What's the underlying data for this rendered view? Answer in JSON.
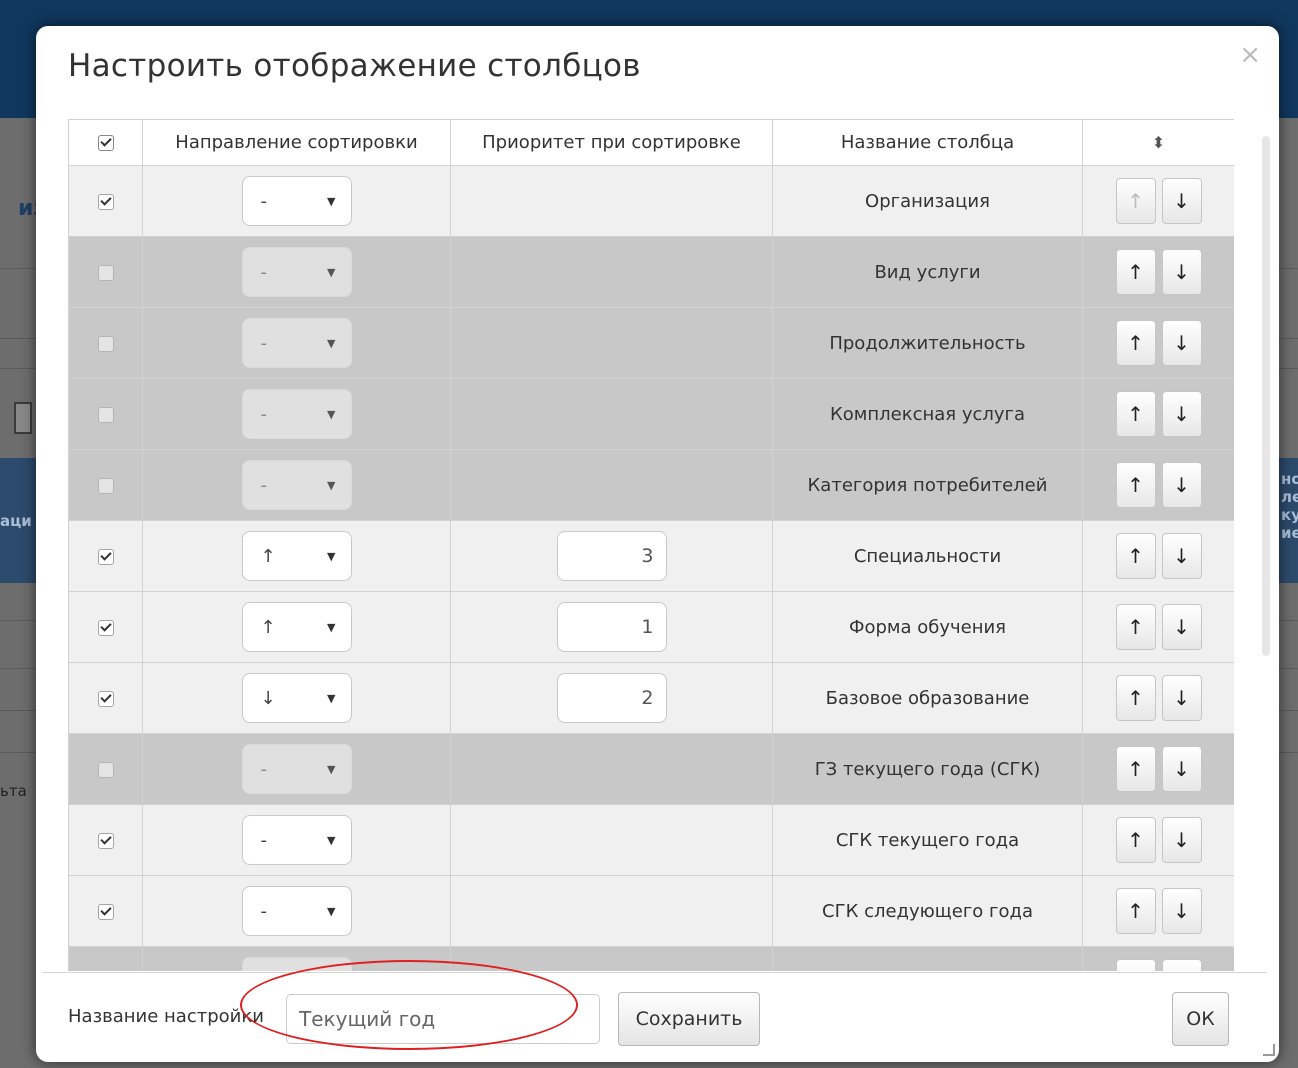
{
  "background": {
    "fragments": [
      "из",
      "аци",
      "ьта"
    ],
    "right_fragments": [
      "но",
      "ле",
      "ку",
      "ие"
    ]
  },
  "dialog": {
    "title": "Настроить отображение столбцов",
    "close_glyph": "×"
  },
  "grid": {
    "headers": {
      "check": "",
      "direction": "Направление сортировки",
      "priority": "Приоритет при сортировке",
      "name": "Название столбца",
      "move": "⬍"
    },
    "up_glyph": "↑",
    "down_glyph": "↓",
    "dropdown_glyph": "▼",
    "rows": [
      {
        "checked": true,
        "direction": "-",
        "priority": "",
        "name": "Организация"
      },
      {
        "checked": false,
        "direction": "-",
        "priority": "",
        "name": "Вид услуги"
      },
      {
        "checked": false,
        "direction": "-",
        "priority": "",
        "name": "Продолжительность"
      },
      {
        "checked": false,
        "direction": "-",
        "priority": "",
        "name": "Комплексная услуга"
      },
      {
        "checked": false,
        "direction": "-",
        "priority": "",
        "name": "Категория потребителей"
      },
      {
        "checked": true,
        "direction": "↑",
        "priority": "3",
        "name": "Специальности"
      },
      {
        "checked": true,
        "direction": "↑",
        "priority": "1",
        "name": "Форма обучения"
      },
      {
        "checked": true,
        "direction": "↓",
        "priority": "2",
        "name": "Базовое образование"
      },
      {
        "checked": false,
        "direction": "-",
        "priority": "",
        "name": "ГЗ текущего года (СГК)"
      },
      {
        "checked": true,
        "direction": "-",
        "priority": "",
        "name": "СГК текущего года"
      },
      {
        "checked": true,
        "direction": "-",
        "priority": "",
        "name": "СГК следующего года"
      },
      {
        "checked": false,
        "direction": "-",
        "priority": "",
        "name": ""
      }
    ]
  },
  "footer": {
    "label": "Название настройки",
    "input_value": "Текущий год",
    "save_label": "Сохранить",
    "ok_label": "ОК"
  },
  "colors": {
    "row_enabled": "#f0f0f0",
    "row_disabled": "#c8c8c8",
    "annotation": "#e02020"
  }
}
